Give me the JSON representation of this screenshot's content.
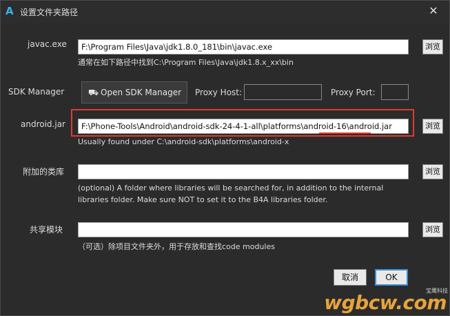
{
  "window": {
    "title": "设置文件夹路径",
    "app_icon": "A",
    "close_glyph": "✕"
  },
  "javac": {
    "label": "javac.exe",
    "value": "F:\\Program Files\\Java\\jdk1.8.0_181\\bin\\javac.exe",
    "hint": "通常在如下路径中找到C:\\Program Files\\Java\\jdk1.8.x_xx\\bin",
    "browse_label": "浏览"
  },
  "sdk": {
    "label": "SDK Manager",
    "button_label": "Open SDK Manager",
    "button_icon": "⛟",
    "proxy_host_label": "Proxy Host:",
    "proxy_host_value": "",
    "proxy_port_label": "Proxy Port:",
    "proxy_port_value": ""
  },
  "android_jar": {
    "label": "android.jar",
    "value": "F:\\Phone-Tools\\Android\\android-sdk-24-4-1-all\\platforms\\android-16\\android.jar",
    "hint": "Usually found under C:\\android-sdk\\platforms\\android-x",
    "browse_label": "浏览",
    "highlight_color": "#e03b2e"
  },
  "libraries": {
    "label": "附加的类库",
    "value": "",
    "hint": "(optional) A folder where libraries will be searched for, in addition to the internal libraries folder. Make sure NOT to set it to the B4A libraries folder.",
    "browse_label": "浏览"
  },
  "shared_modules": {
    "label": "共享模块",
    "value": "",
    "hint": "（可选）除项目文件夹外，用于存放和查找code modules",
    "browse_label": "浏览"
  },
  "footer": {
    "cancel_label": "取消",
    "ok_label": "OK"
  },
  "watermark": {
    "small": "宝鹰科技",
    "big": "wgbcw.com"
  },
  "colors": {
    "background": "#2b2b2b",
    "accent": "#3c8fd6",
    "highlight": "#e03b2e"
  }
}
